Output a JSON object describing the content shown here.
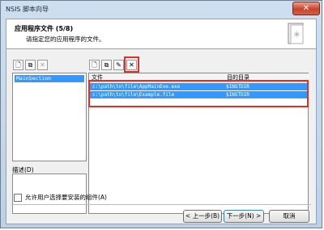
{
  "window": {
    "title": "NSIS 脚本向导",
    "close_glyph": "✕"
  },
  "header": {
    "title": "应用程序文件 (5/8)",
    "subtitle": "请指定您的应用程序的文件。",
    "icon": "wizard-book-icon"
  },
  "left_panel": {
    "section_items": [
      "MainSection"
    ],
    "description_label": "描述(D)"
  },
  "file_panel": {
    "columns": [
      "文件",
      "目的目录"
    ],
    "rows": [
      {
        "file": "c:\\path\\to\\file\\AppMainExe.exe",
        "dest": "$INSTDIR"
      },
      {
        "file": "c:\\path\\to\\file\\Example.file",
        "dest": "$INSTDIR"
      }
    ]
  },
  "checkbox": {
    "label": "允许用户选择要安装的组件(A)",
    "checked": false
  },
  "buttons": {
    "back": "< 上一步(B)",
    "next": "下一步(N) >",
    "cancel": "取消"
  },
  "colors": {
    "selection": "#3399ff",
    "highlight_box": "#e0302a"
  }
}
